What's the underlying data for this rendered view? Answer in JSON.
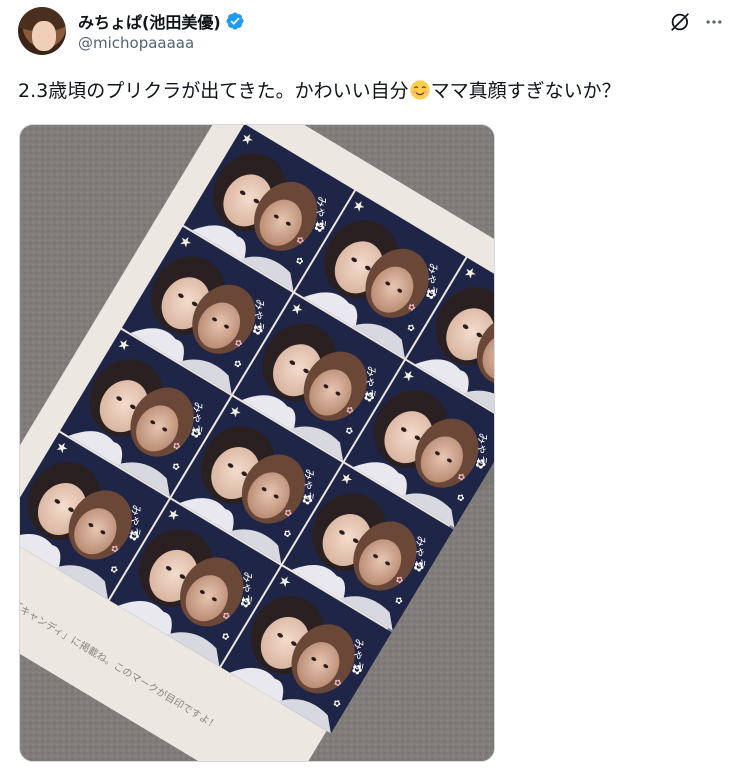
{
  "author": {
    "display_name": "みちょぱ(池田美優)",
    "handle": "@michopaaaaa",
    "verified": true
  },
  "post": {
    "text_before_emoji": "2.3歳頃のプリクラが出てきた。かわいい自分",
    "emoji": "smiling-face-blush-emoji",
    "text_after_emoji": "ママ真顔すぎないか？",
    "sticker_caption": "週刊「キャンディ」に掲載ね。このマークが目印ですよ！"
  },
  "icons": {
    "verified": "verified-badge-icon",
    "grok": "grok-icon",
    "more": "more-icon"
  },
  "colors": {
    "verified_blue": "#1d9bf0",
    "text": "#0f1419",
    "secondary": "#536471"
  }
}
